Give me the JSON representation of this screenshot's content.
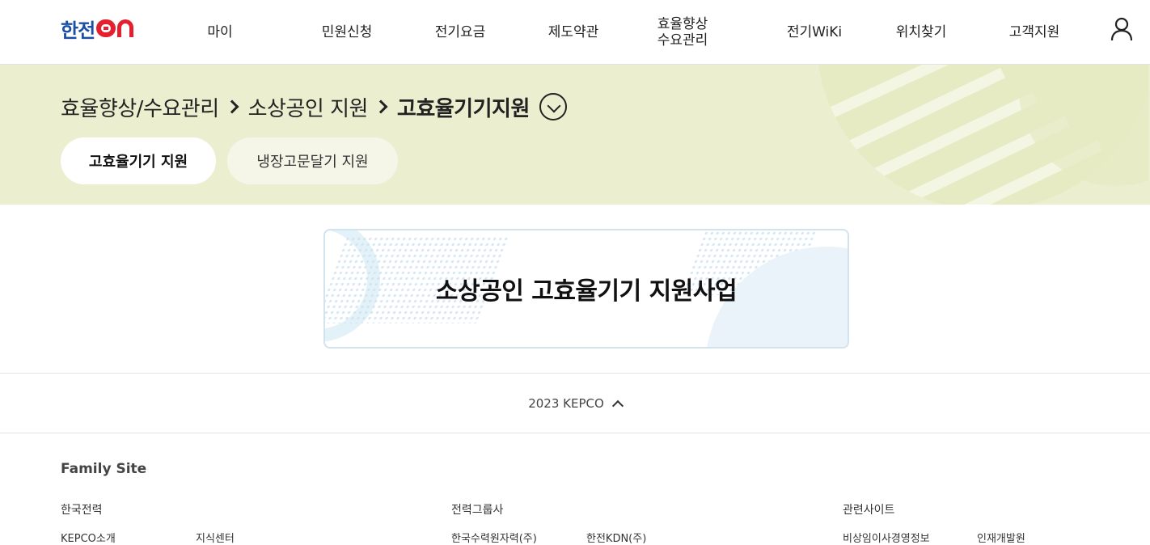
{
  "header": {
    "logo": {
      "text": "한전",
      "on": "ON"
    },
    "nav": [
      {
        "label": "마이",
        "id": "my"
      },
      {
        "label": "민원신청",
        "id": "complaint"
      },
      {
        "label": "전기요금",
        "id": "bill"
      },
      {
        "label": "제도약관",
        "id": "terms"
      },
      {
        "label": "효율향상\n수요관리",
        "id": "efficiency"
      },
      {
        "label": "전기WiKi",
        "id": "wiki"
      },
      {
        "label": "위치찾기",
        "id": "location"
      },
      {
        "label": "고객지원",
        "id": "support"
      }
    ],
    "user_icon": "user-icon"
  },
  "breadcrumb": {
    "items": [
      "효율향상/수요관리",
      "소상공인 지원"
    ],
    "current": "고효율기기지원",
    "toggle_icon": "chevron-down-circle-icon"
  },
  "tabs": [
    {
      "label": "고효율기기 지원",
      "active": true
    },
    {
      "label": "냉장고문달기 지원",
      "active": false
    }
  ],
  "card": {
    "title": "소상공인 고효율기기 지원사업"
  },
  "footer": {
    "copyright": "2023 KEPCO",
    "toggle_icon": "chevron-up-icon",
    "family_title": "Family Site",
    "groups": [
      {
        "title": "한국전력",
        "links": [
          "KEPCO소개",
          "지식센터"
        ]
      },
      {
        "title": "전력그룹사",
        "links": [
          "한국수력원자력(주)",
          "한전KDN(주)"
        ]
      },
      {
        "title": "관련사이트",
        "links": [
          "비상임이사경영정보",
          "인재개발원"
        ]
      }
    ]
  },
  "colors": {
    "brand_blue": "#1b4fa3",
    "brand_red": "#e5202e",
    "banner_bg": "#ebefd0",
    "tab_inactive_bg": "#f5f6e8",
    "card_border": "#d3e3ee"
  }
}
